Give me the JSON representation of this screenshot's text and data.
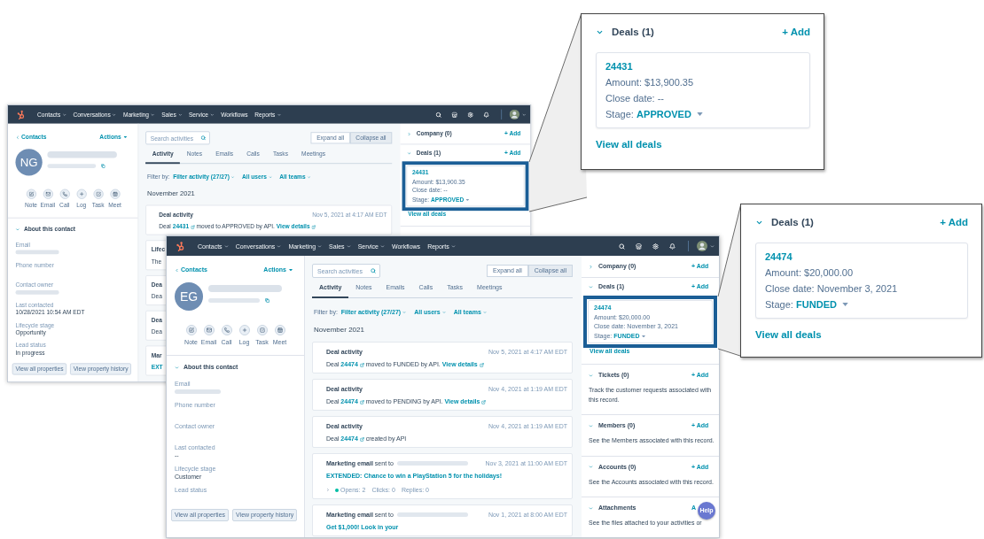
{
  "windows": [
    {
      "menu": [
        {
          "label": "Contacts",
          "dropdown": true
        },
        {
          "label": "Conversations",
          "dropdown": true
        },
        {
          "label": "Marketing",
          "dropdown": true
        },
        {
          "label": "Sales",
          "dropdown": true
        },
        {
          "label": "Service",
          "dropdown": true
        },
        {
          "label": "Workflows",
          "dropdown": false
        },
        {
          "label": "Reports",
          "dropdown": true
        }
      ],
      "contact": {
        "back": "Contacts",
        "actions": "Actions",
        "initials": "NG",
        "name_blurred": true,
        "email_blurred": true,
        "tools": [
          "Note",
          "Email",
          "Call",
          "Log",
          "Task",
          "Meet"
        ],
        "about": {
          "title": "About this contact",
          "expanded": true
        },
        "fields": [
          {
            "label": "Email",
            "blurred": true
          },
          {
            "label": "Phone number",
            "blurred": false
          },
          {
            "label": "Contact owner",
            "blurred": true
          },
          {
            "label": "Last contacted",
            "value": "10/28/2021 10:54 AM EDT",
            "blurred": false
          },
          {
            "label": "Lifecycle stage",
            "value": "Opportunity",
            "blurred": false
          },
          {
            "label": "Lead status",
            "value": "In progress",
            "blurred": false
          }
        ],
        "buttons": [
          "View all properties",
          "View property history"
        ]
      },
      "activity": {
        "search": {
          "placeholder": "Search activities"
        },
        "toggle": [
          {
            "label": "Expand all",
            "selected": false
          },
          {
            "label": "Collapse all",
            "selected": true
          }
        ],
        "tabs": [
          {
            "label": "Activity",
            "selected": true
          },
          {
            "label": "Notes",
            "selected": false
          },
          {
            "label": "Emails",
            "selected": false
          },
          {
            "label": "Calls",
            "selected": false
          },
          {
            "label": "Tasks",
            "selected": false
          },
          {
            "label": "Meetings",
            "selected": false
          }
        ],
        "filter": {
          "label": "Filter by:",
          "options": [
            "Filter activity (27/27)",
            "All users",
            "All teams"
          ]
        },
        "month": "November 2021",
        "items": [
          {
            "kind": "deal",
            "title": "Deal activity",
            "time": "Nov 5, 2021 at 4:17 AM EDT",
            "prefix": "Deal",
            "deal_id": "24431",
            "action": "moved to APPROVED by API.",
            "link": "View details"
          },
          {
            "kind": "partial",
            "title": "Lifec",
            "text": "The"
          },
          {
            "kind": "partial",
            "title": "Dea",
            "text": "Dea"
          },
          {
            "kind": "partial",
            "title": "Dea",
            "text": "Dea"
          },
          {
            "kind": "partial",
            "title": "Mar",
            "subject": "EXT"
          }
        ]
      },
      "sidebar": {
        "sections": [
          {
            "title": "Company (0)",
            "expanded": false,
            "add": "+ Add"
          },
          {
            "title": "Deals (1)",
            "expanded": true,
            "add": "+ Add",
            "deal": {
              "id": "24431",
              "amount": "Amount: $13,900.35",
              "close": "Close date: --",
              "stage_label": "Stage:",
              "stage": "APPROVED",
              "highlighted": true
            },
            "link": "View all deals"
          }
        ]
      }
    },
    {
      "menu": [
        {
          "label": "Contacts",
          "dropdown": true
        },
        {
          "label": "Conversations",
          "dropdown": true
        },
        {
          "label": "Marketing",
          "dropdown": true
        },
        {
          "label": "Sales",
          "dropdown": true
        },
        {
          "label": "Service",
          "dropdown": true
        },
        {
          "label": "Workflows",
          "dropdown": false
        },
        {
          "label": "Reports",
          "dropdown": true
        }
      ],
      "contact": {
        "back": "Contacts",
        "actions": "Actions",
        "initials": "EG",
        "name_blurred": true,
        "email_blurred": true,
        "tools": [
          "Note",
          "Email",
          "Call",
          "Log",
          "Task",
          "Meet"
        ],
        "about": {
          "title": "About this contact",
          "expanded": true
        },
        "fields": [
          {
            "label": "Email",
            "blurred": true
          },
          {
            "label": "Phone number",
            "blurred": false
          },
          {
            "label": "Contact owner",
            "blurred": false
          },
          {
            "label": "Last contacted",
            "value": "--",
            "blurred": false
          },
          {
            "label": "Lifecycle stage",
            "value": "Customer",
            "blurred": false
          },
          {
            "label": "Lead status",
            "blurred": false
          }
        ],
        "buttons": [
          "View all properties",
          "View property history"
        ]
      },
      "activity": {
        "search": {
          "placeholder": "Search activities"
        },
        "toggle": [
          {
            "label": "Expand all",
            "selected": false
          },
          {
            "label": "Collapse all",
            "selected": true
          }
        ],
        "tabs": [
          {
            "label": "Activity",
            "selected": true
          },
          {
            "label": "Notes",
            "selected": false
          },
          {
            "label": "Emails",
            "selected": false
          },
          {
            "label": "Calls",
            "selected": false
          },
          {
            "label": "Tasks",
            "selected": false
          },
          {
            "label": "Meetings",
            "selected": false
          }
        ],
        "filter": {
          "label": "Filter by:",
          "options": [
            "Filter activity (27/27)",
            "All users",
            "All teams"
          ]
        },
        "month": "November 2021",
        "items": [
          {
            "kind": "deal",
            "title": "Deal activity",
            "time": "Nov 5, 2021 at 4:17 AM EDT",
            "prefix": "Deal",
            "deal_id": "24474",
            "action": "moved to FUNDED by API.",
            "link": "View details"
          },
          {
            "kind": "deal",
            "title": "Deal activity",
            "time": "Nov 4, 2021 at 1:19 AM EDT",
            "prefix": "Deal",
            "deal_id": "24474",
            "action": "moved to PENDING by API.",
            "link": "View details"
          },
          {
            "kind": "deal",
            "title": "Deal activity",
            "time": "Nov 4, 2021 at 1:19 AM EDT",
            "prefix": "Deal",
            "deal_id": "24474",
            "action": "created by API"
          },
          {
            "kind": "email",
            "title": "**Marketing email** sent to",
            "recipient_blurred": true,
            "time": "Nov 3, 2021 at 11:00 AM EDT",
            "subject": "EXTENDED: Chance to win a PlayStation 5 for the holidays!",
            "stats": [
              "Opens: 2",
              "Clicks: 0",
              "Replies: 0"
            ]
          },
          {
            "kind": "email",
            "title": "**Marketing email** sent to",
            "recipient_blurred": true,
            "time": "Nov 1, 2021 at 8:00 AM EDT",
            "subject": "Get $1,000! Look in your"
          }
        ]
      },
      "sidebar": {
        "sections": [
          {
            "title": "Company (0)",
            "expanded": false,
            "add": "+ Add"
          },
          {
            "title": "Deals (1)",
            "expanded": true,
            "add": "+ Add",
            "deal": {
              "id": "24474",
              "amount": "Amount: $20,000.00",
              "close": "Close date: November 3, 2021",
              "stage_label": "Stage:",
              "stage": "FUNDED",
              "highlighted": true
            },
            "link": "View all deals"
          },
          {
            "title": "Tickets (0)",
            "expanded": true,
            "add": "+ Add",
            "text": "Track the customer requests associated with this record."
          },
          {
            "title": "Members (0)",
            "expanded": true,
            "add": "+ Add",
            "text": "See the Members associated with this record."
          },
          {
            "title": "Accounts (0)",
            "expanded": true,
            "add": "+ Add",
            "text": "See the Accounts associated with this record."
          },
          {
            "title": "Attachments",
            "expanded": true,
            "add": "A",
            "text": "See the files attached to your activities or"
          }
        ]
      },
      "help": "Help"
    }
  ],
  "callouts": [
    {
      "title": "Deals (1)",
      "expanded": true,
      "add": "+ Add",
      "deal": {
        "id": "24431",
        "amount": "Amount: $13,900.35",
        "close": "Close date: --",
        "stage_label": "Stage:",
        "stage": "APPROVED"
      },
      "link": "View all deals"
    },
    {
      "title": "Deals (1)",
      "expanded": true,
      "add": "+ Add",
      "deal": {
        "id": "24474",
        "amount": "Amount: $20,000.00",
        "close": "Close date: November 3, 2021",
        "stage_label": "Stage:",
        "stage": "FUNDED"
      },
      "link": "View all deals"
    }
  ]
}
